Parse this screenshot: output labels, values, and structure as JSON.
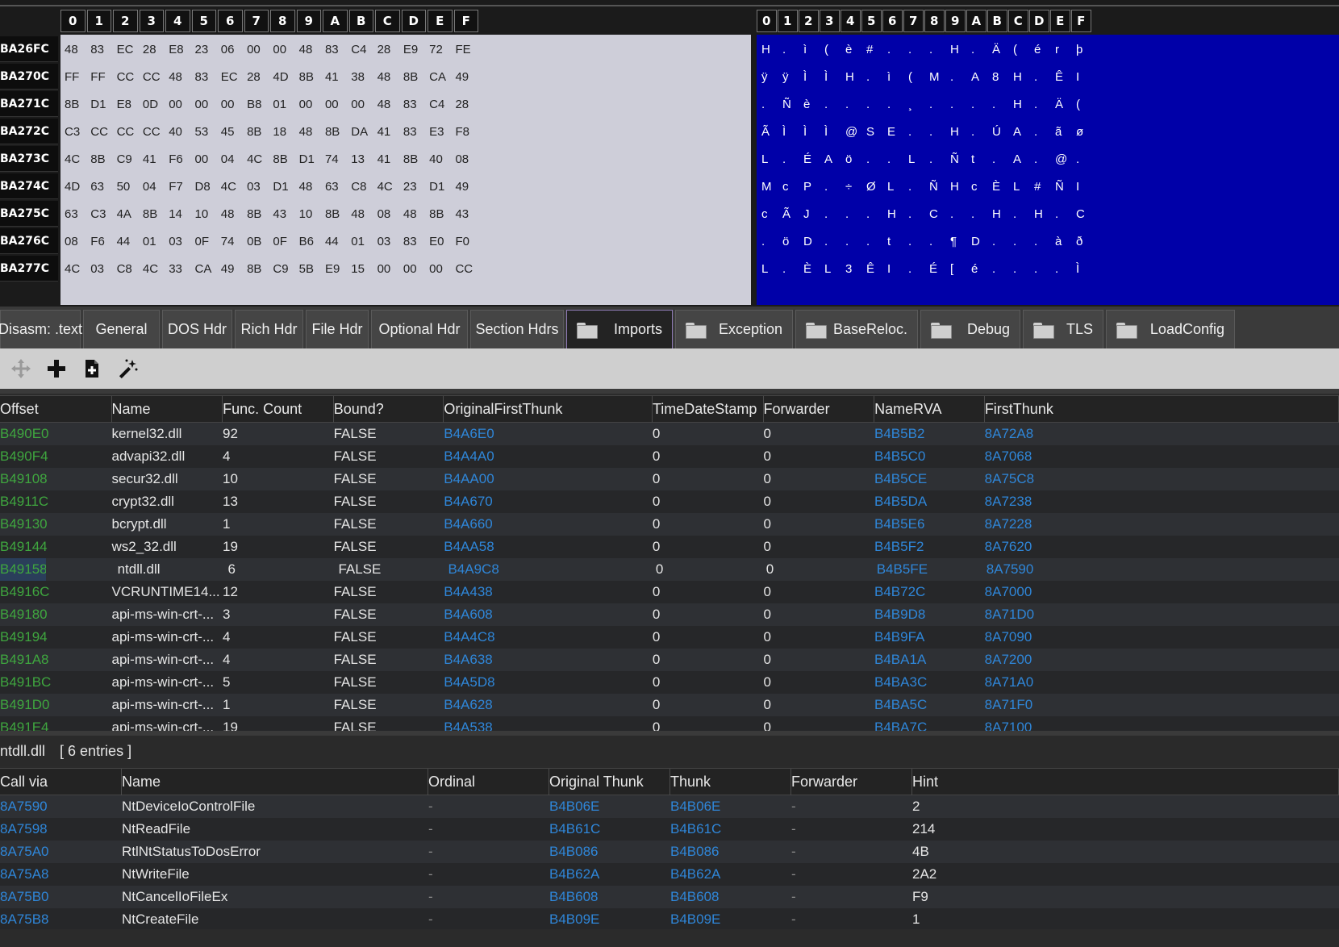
{
  "hex": {
    "columns": [
      "0",
      "1",
      "2",
      "3",
      "4",
      "5",
      "6",
      "7",
      "8",
      "9",
      "A",
      "B",
      "C",
      "D",
      "E",
      "F"
    ],
    "rows": [
      {
        "addr": "BA26FC",
        "bytes": [
          "48",
          "83",
          "EC",
          "28",
          "E8",
          "23",
          "06",
          "00",
          "00",
          "48",
          "83",
          "C4",
          "28",
          "E9",
          "72",
          "FE"
        ],
        "ascii": [
          "H",
          ".",
          "ì",
          "(",
          "è",
          "#",
          ".",
          ".",
          ".",
          "H",
          ".",
          "Ä",
          "(",
          "é",
          "r",
          "þ"
        ]
      },
      {
        "addr": "BA270C",
        "bytes": [
          "FF",
          "FF",
          "CC",
          "CC",
          "48",
          "83",
          "EC",
          "28",
          "4D",
          "8B",
          "41",
          "38",
          "48",
          "8B",
          "CA",
          "49"
        ],
        "ascii": [
          "ÿ",
          "ÿ",
          "Ì",
          "Ì",
          "H",
          ".",
          "ì",
          "(",
          "M",
          ".",
          "A",
          "8",
          "H",
          ".",
          "Ê",
          "I"
        ]
      },
      {
        "addr": "BA271C",
        "bytes": [
          "8B",
          "D1",
          "E8",
          "0D",
          "00",
          "00",
          "00",
          "B8",
          "01",
          "00",
          "00",
          "00",
          "48",
          "83",
          "C4",
          "28"
        ],
        "ascii": [
          ".",
          "Ñ",
          "è",
          ".",
          ".",
          ".",
          ".",
          "¸",
          ".",
          ".",
          ".",
          ".",
          "H",
          ".",
          "Ä",
          "("
        ]
      },
      {
        "addr": "BA272C",
        "bytes": [
          "C3",
          "CC",
          "CC",
          "CC",
          "40",
          "53",
          "45",
          "8B",
          "18",
          "48",
          "8B",
          "DA",
          "41",
          "83",
          "E3",
          "F8"
        ],
        "ascii": [
          "Ã",
          "Ì",
          "Ì",
          "Ì",
          "@",
          "S",
          "E",
          ".",
          ".",
          "H",
          ".",
          "Ú",
          "A",
          ".",
          "ã",
          "ø"
        ]
      },
      {
        "addr": "BA273C",
        "bytes": [
          "4C",
          "8B",
          "C9",
          "41",
          "F6",
          "00",
          "04",
          "4C",
          "8B",
          "D1",
          "74",
          "13",
          "41",
          "8B",
          "40",
          "08"
        ],
        "ascii": [
          "L",
          ".",
          "É",
          "A",
          "ö",
          ".",
          ".",
          "L",
          ".",
          "Ñ",
          "t",
          ".",
          "A",
          ".",
          "@",
          "."
        ]
      },
      {
        "addr": "BA274C",
        "bytes": [
          "4D",
          "63",
          "50",
          "04",
          "F7",
          "D8",
          "4C",
          "03",
          "D1",
          "48",
          "63",
          "C8",
          "4C",
          "23",
          "D1",
          "49"
        ],
        "ascii": [
          "M",
          "c",
          "P",
          ".",
          "÷",
          "Ø",
          "L",
          ".",
          "Ñ",
          "H",
          "c",
          "È",
          "L",
          "#",
          "Ñ",
          "I"
        ]
      },
      {
        "addr": "BA275C",
        "bytes": [
          "63",
          "C3",
          "4A",
          "8B",
          "14",
          "10",
          "48",
          "8B",
          "43",
          "10",
          "8B",
          "48",
          "08",
          "48",
          "8B",
          "43"
        ],
        "ascii": [
          "c",
          "Ã",
          "J",
          ".",
          ".",
          ".",
          "H",
          ".",
          "C",
          ".",
          ".",
          "H",
          ".",
          "H",
          ".",
          "C"
        ]
      },
      {
        "addr": "BA276C",
        "bytes": [
          "08",
          "F6",
          "44",
          "01",
          "03",
          "0F",
          "74",
          "0B",
          "0F",
          "B6",
          "44",
          "01",
          "03",
          "83",
          "E0",
          "F0"
        ],
        "ascii": [
          ".",
          "ö",
          "D",
          ".",
          ".",
          ".",
          "t",
          ".",
          ".",
          "¶",
          "D",
          ".",
          ".",
          ".",
          "à",
          "ð"
        ]
      },
      {
        "addr": "BA277C",
        "bytes": [
          "4C",
          "03",
          "C8",
          "4C",
          "33",
          "CA",
          "49",
          "8B",
          "C9",
          "5B",
          "E9",
          "15",
          "00",
          "00",
          "00",
          "CC"
        ],
        "ascii": [
          "L",
          ".",
          "È",
          "L",
          "3",
          "Ê",
          "I",
          ".",
          "É",
          "[",
          "é",
          ".",
          ".",
          ".",
          ".",
          "Ì"
        ]
      }
    ]
  },
  "tabs": [
    {
      "label": "Disasm: .text",
      "folder": false,
      "active": false
    },
    {
      "label": "General",
      "folder": false,
      "active": false
    },
    {
      "label": "DOS Hdr",
      "folder": false,
      "active": false
    },
    {
      "label": "Rich Hdr",
      "folder": false,
      "active": false
    },
    {
      "label": "File Hdr",
      "folder": false,
      "active": false
    },
    {
      "label": "Optional Hdr",
      "folder": false,
      "active": false
    },
    {
      "label": "Section Hdrs",
      "folder": false,
      "active": false
    },
    {
      "label": "Imports",
      "folder": true,
      "active": true
    },
    {
      "label": "Exception",
      "folder": true,
      "active": false
    },
    {
      "label": "BaseReloc.",
      "folder": true,
      "active": false
    },
    {
      "label": "Debug",
      "folder": true,
      "active": false
    },
    {
      "label": "TLS",
      "folder": true,
      "active": false
    },
    {
      "label": "LoadConfig",
      "folder": true,
      "active": false
    }
  ],
  "toolbar": {
    "icons": [
      "move-icon",
      "add-icon",
      "add-file-icon",
      "magic-wand-icon"
    ]
  },
  "imports": {
    "columns": [
      "Offset",
      "Name",
      "Func. Count",
      "Bound?",
      "OriginalFirstThunk",
      "TimeDateStamp",
      "Forwarder",
      "NameRVA",
      "FirstThunk"
    ],
    "rows": [
      [
        "B490E0",
        "kernel32.dll",
        "92",
        "FALSE",
        "B4A6E0",
        "0",
        "0",
        "B4B5B2",
        "8A72A8"
      ],
      [
        "B490F4",
        "advapi32.dll",
        "4",
        "FALSE",
        "B4A4A0",
        "0",
        "0",
        "B4B5C0",
        "8A7068"
      ],
      [
        "B49108",
        "secur32.dll",
        "10",
        "FALSE",
        "B4AA00",
        "0",
        "0",
        "B4B5CE",
        "8A75C8"
      ],
      [
        "B4911C",
        "crypt32.dll",
        "13",
        "FALSE",
        "B4A670",
        "0",
        "0",
        "B4B5DA",
        "8A7238"
      ],
      [
        "B49130",
        "bcrypt.dll",
        "1",
        "FALSE",
        "B4A660",
        "0",
        "0",
        "B4B5E6",
        "8A7228"
      ],
      [
        "B49144",
        "ws2_32.dll",
        "19",
        "FALSE",
        "B4AA58",
        "0",
        "0",
        "B4B5F2",
        "8A7620"
      ],
      [
        "B49158",
        "ntdll.dll",
        "6",
        "FALSE",
        "B4A9C8",
        "0",
        "0",
        "B4B5FE",
        "8A7590"
      ],
      [
        "B4916C",
        "VCRUNTIME14...",
        "12",
        "FALSE",
        "B4A438",
        "0",
        "0",
        "B4B72C",
        "8A7000"
      ],
      [
        "B49180",
        "api-ms-win-crt-...",
        "3",
        "FALSE",
        "B4A608",
        "0",
        "0",
        "B4B9D8",
        "8A71D0"
      ],
      [
        "B49194",
        "api-ms-win-crt-...",
        "4",
        "FALSE",
        "B4A4C8",
        "0",
        "0",
        "B4B9FA",
        "8A7090"
      ],
      [
        "B491A8",
        "api-ms-win-crt-...",
        "4",
        "FALSE",
        "B4A638",
        "0",
        "0",
        "B4BA1A",
        "8A7200"
      ],
      [
        "B491BC",
        "api-ms-win-crt-...",
        "5",
        "FALSE",
        "B4A5D8",
        "0",
        "0",
        "B4BA3C",
        "8A71A0"
      ],
      [
        "B491D0",
        "api-ms-win-crt-...",
        "1",
        "FALSE",
        "B4A628",
        "0",
        "0",
        "B4BA5C",
        "8A71F0"
      ],
      [
        "B491E4",
        "api-ms-win-crt-...",
        "19",
        "FALSE",
        "B4A538",
        "0",
        "0",
        "B4BA7C",
        "8A7100"
      ]
    ]
  },
  "selected_library": {
    "name": "ntdll.dll",
    "entries": "[ 6 entries ]"
  },
  "functions": {
    "columns": [
      "Call via",
      "Name",
      "Ordinal",
      "Original Thunk",
      "Thunk",
      "Forwarder",
      "Hint"
    ],
    "rows": [
      [
        "8A7590",
        "NtDeviceIoControlFile",
        "-",
        "B4B06E",
        "B4B06E",
        "-",
        "2"
      ],
      [
        "8A7598",
        "NtReadFile",
        "-",
        "B4B61C",
        "B4B61C",
        "-",
        "214"
      ],
      [
        "8A75A0",
        "RtlNtStatusToDosError",
        "-",
        "B4B086",
        "B4B086",
        "-",
        "4B"
      ],
      [
        "8A75A8",
        "NtWriteFile",
        "-",
        "B4B62A",
        "B4B62A",
        "-",
        "2A2"
      ],
      [
        "8A75B0",
        "NtCancelIoFileEx",
        "-",
        "B4B608",
        "B4B608",
        "-",
        "F9"
      ],
      [
        "8A75B8",
        "NtCreateFile",
        "-",
        "B4B09E",
        "B4B09E",
        "-",
        "1"
      ]
    ]
  },
  "colors": {
    "offset_green": "#3fa63f",
    "link_blue": "#2f86d8",
    "ascii_background": "#0000a8",
    "hex_background": "#ceced9"
  }
}
